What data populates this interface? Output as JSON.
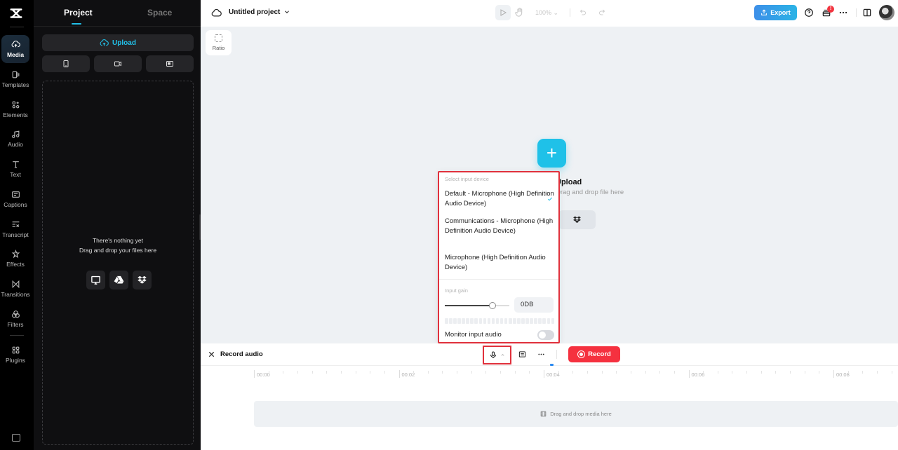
{
  "rail": {
    "items": [
      {
        "label": "Media",
        "icon": "cloud-upload-icon",
        "active": true
      },
      {
        "label": "Templates",
        "icon": "templates-icon"
      },
      {
        "label": "Elements",
        "icon": "elements-icon"
      },
      {
        "label": "Audio",
        "icon": "music-note-icon"
      },
      {
        "label": "Text",
        "icon": "text-icon"
      },
      {
        "label": "Captions",
        "icon": "captions-icon"
      },
      {
        "label": "Transcript",
        "icon": "transcript-icon"
      },
      {
        "label": "Effects",
        "icon": "effects-icon"
      },
      {
        "label": "Transitions",
        "icon": "transitions-icon"
      },
      {
        "label": "Filters",
        "icon": "filters-icon"
      },
      {
        "label": "Plugins",
        "icon": "plugins-icon"
      }
    ]
  },
  "panel": {
    "tabs": [
      {
        "label": "Project",
        "active": true
      },
      {
        "label": "Space"
      }
    ],
    "upload_label": "Upload",
    "source_buttons": [
      "phone-icon",
      "camera-icon",
      "screen-record-icon"
    ],
    "empty_title": "There's nothing yet",
    "empty_subtitle": "Drag and drop your files here",
    "cloud_sources": [
      "computer-icon",
      "google-drive-icon",
      "dropbox-icon"
    ]
  },
  "topbar": {
    "project_title": "Untitled project",
    "zoom_level": "100%",
    "export_label": "Export",
    "notification_badge": "!"
  },
  "canvas": {
    "ratio_label": "Ratio",
    "upload_label": "Upload",
    "upload_hint": "Drag and drop file here"
  },
  "input_device_popover": {
    "section_label": "Select input device",
    "devices": [
      {
        "label": "Default - Microphone (High Definition Audio Device)",
        "selected": true
      },
      {
        "label": "Communications - Microphone (High Definition Audio Device)",
        "selected": false
      },
      {
        "label": "Microphone (High Definition Audio Device)",
        "selected": false
      }
    ],
    "gain_label": "Input gain",
    "gain_value": "0DB",
    "gain_slider_fraction": 0.74,
    "monitor_label": "Monitor input audio",
    "monitor_enabled": false
  },
  "record_bar": {
    "title": "Record audio",
    "record_label": "Record"
  },
  "timeline": {
    "tick_labels": [
      "00:00",
      "00:02",
      "00:04",
      "00:06",
      "00:08"
    ],
    "track_placeholder": "Drag and drop media here"
  },
  "colors": {
    "accent": "#22c0e8",
    "record": "#f5313f",
    "highlight_border": "#e0313c",
    "export_gradient_start": "#3d8fe8",
    "export_gradient_end": "#2ab3e6"
  }
}
